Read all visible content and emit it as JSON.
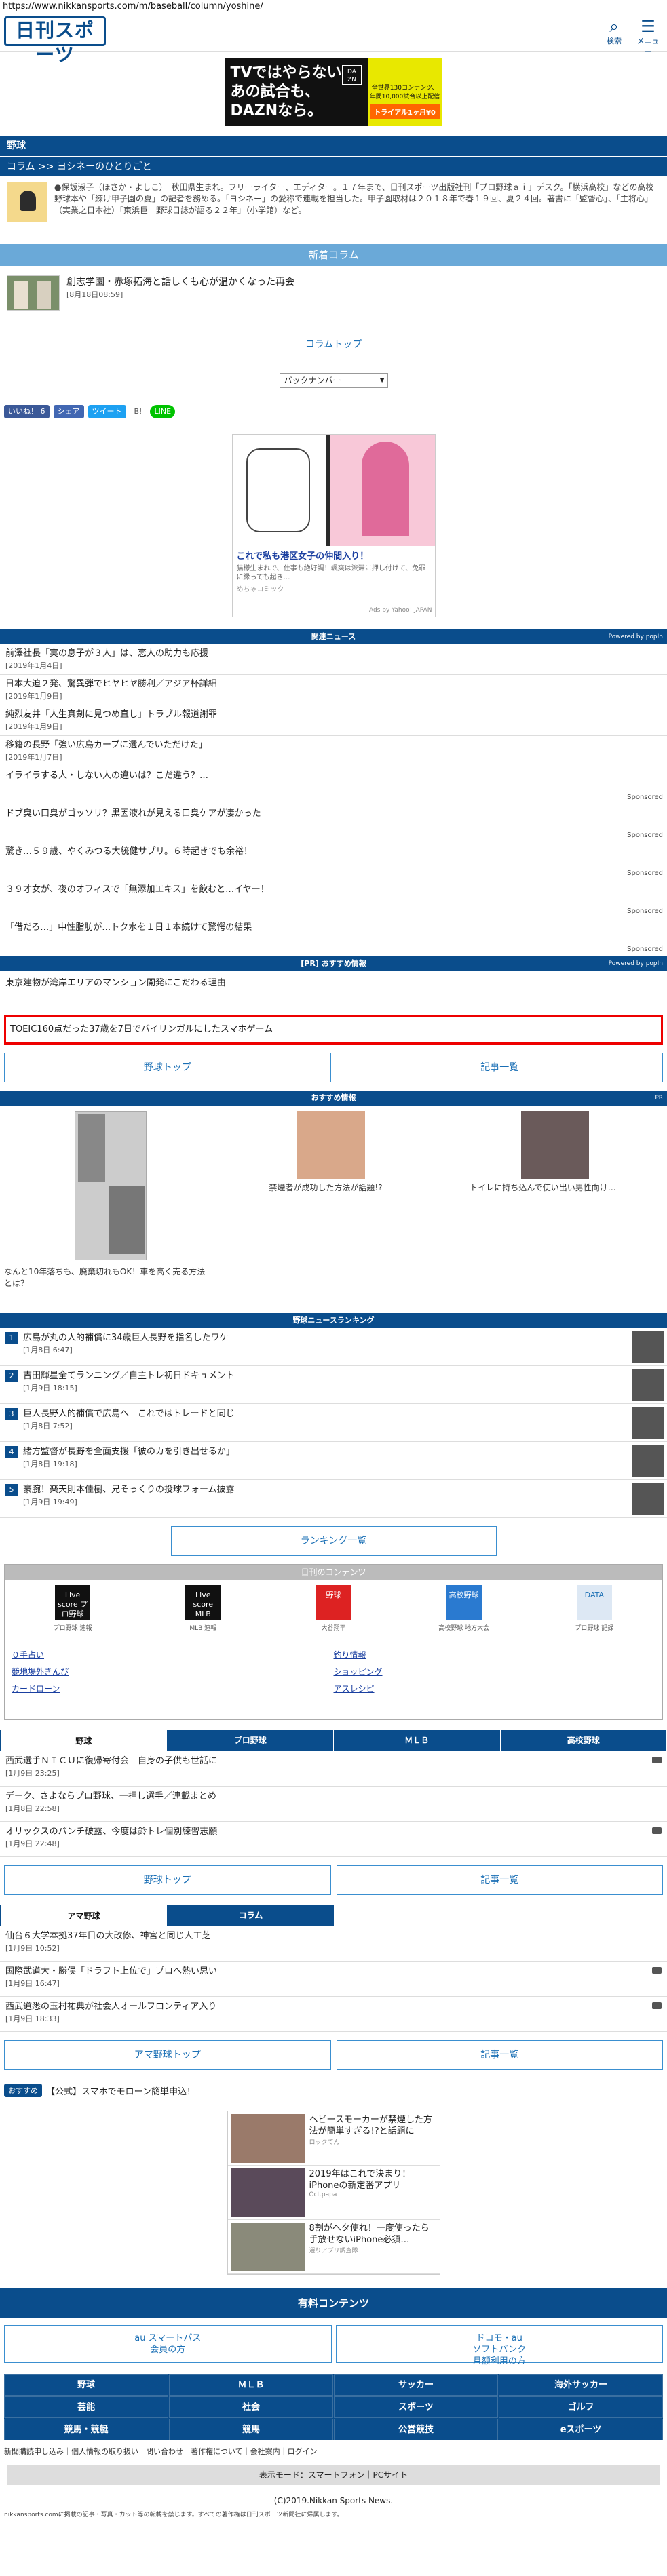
{
  "url": "https://www.nikkansports.com/m/baseball/column/yoshine/",
  "header": {
    "logo": "日刊スポーツ",
    "search_label": "検索",
    "menu_label": "メニュー"
  },
  "banner": {
    "line1": "TVではやらない",
    "line2": "あの試合も、",
    "line3": "DAZNなら。",
    "right1": "全世界130コンテンツ、",
    "right2": "年間10,000試合以上配信",
    "cta": "トライアル1ヶ月¥0"
  },
  "section": "野球",
  "column_title": "コラム >> ヨシネーのひとりごと",
  "profile": "●保坂淑子（ほさか・よしこ）　秋田県生まれ。フリーライター、エディター。１７年まで、日刊スポーツ出版社刊「プロ野球ａｉ」デスク。「横浜高校」などの高校野球本や「練け甲子園の夏」の記者を務める。「ヨシネー」の愛称で連載を担当した。甲子園取材は２０１８年で春１９回、夏２４回。著書に「監督心」、「主将心」（実業之日本社）「東浜巨　野球日誌が語る２２年」（小学館）など。",
  "new_column": {
    "head": "新着コラム",
    "title": "創志学園・赤塚拓海と話しくも心が温かくなった再会",
    "date": "[8月18日08:59]"
  },
  "column_top": "コラムトップ",
  "backnumber": "バックナンバー",
  "social": {
    "like": "いいね！ 6",
    "share": "シェア",
    "tweet": "ツイート",
    "line": "LINE"
  },
  "ad1": {
    "title": "これで私も港区女子の仲間入り！",
    "desc": "猫様生まれで、仕事も絶好調！颯爽は渋滞に押し付けて、免罪に縁っても起き…",
    "source": "めちゃコミック",
    "yahoo": "Ads by Yahoo! JAPAN"
  },
  "related": {
    "head": "関連ニュース",
    "powered": "Powered by popIn",
    "items": [
      {
        "t": "前澤社長「実の息子が３人」は、恋人の助力も応援",
        "d": "[2019年1月4日]"
      },
      {
        "t": "日本大迫２発、驚異弾でヒヤヒヤ勝利／アジア杯詳細",
        "d": "[2019年1月9日]"
      },
      {
        "t": "純烈友井「人生真剣に見つめ直し」トラブル報道謝罪",
        "d": "[2019年1月9日]"
      },
      {
        "t": "移籍の長野「強い広島カープに選んでいただけた」",
        "d": "[2019年1月7日]"
      }
    ],
    "sponsored": [
      "イライラする人・しない人の違いは？こだ違う？…",
      "ドブ臭い口臭がゴッソリ？黒因液れが見える口臭ケアが凄かった",
      "驚き…５９歳、やくみつる大統健サプリ。６時起きでも余裕！",
      "３９才女が、夜のオフィスで「無添加エキス」を飲むと…イヤー！",
      "「借だろ…」中性脂肪が…トク水を１日１本続けて驚愕の結果"
    ],
    "sponsored_label": "Sponsored"
  },
  "pr": {
    "head": "[PR] おすすめ情報",
    "powered": "Powered by popIn",
    "item": "東京建物が湾岸エリアのマンション開発にこだわる理由"
  },
  "red_item": "TOEIC160点だった37歳を7日でバイリンガルにしたスマホゲーム",
  "buttons1": {
    "left": "野球トップ",
    "right": "記事一覧"
  },
  "recommend": {
    "head": "おすすめ情報",
    "pr": "PR",
    "c1": "なんと10年落ちも、廃棄切れもOK！車を高く売る方法とは？",
    "c2": "禁煙者が成功した方法が話題!?",
    "c3": "トイレに持ち込んで使い出い男性向け…"
  },
  "ranking": {
    "head": "野球ニュースランキング",
    "items": [
      {
        "n": "1",
        "t": "広島が丸の人的補償に34歳巨人長野を指名したワケ",
        "d": "[1月8日 6:47]"
      },
      {
        "n": "2",
        "t": "吉田輝星全てランニング／自主トレ初日ドキュメント",
        "d": "[1月9日 18:15]"
      },
      {
        "n": "3",
        "t": "巨人長野人的補償で広島へ　これではトレードと同じ",
        "d": "[1月8日 7:52]"
      },
      {
        "n": "4",
        "t": "緒方監督が長野を全面支援「彼のカを引き出せるか」",
        "d": "[1月8日 19:18]"
      },
      {
        "n": "5",
        "t": "豪腕！楽天則本佳樹、兄そっくりの投球フォーム披露",
        "d": "[1月9日 19:49]"
      }
    ],
    "more": "ランキング一覧"
  },
  "paid": {
    "head": "日刊のコンテンツ",
    "apps": [
      {
        "icon": "Live score プロ野球",
        "label": "プロ野球 速報"
      },
      {
        "icon": "Live score MLB",
        "label": "MLB 速報"
      },
      {
        "icon": "野球",
        "label": "大谷翔平"
      },
      {
        "icon": "高校野球",
        "label": "高校野球 地方大会"
      },
      {
        "icon": "DATA",
        "label": "プロ野球 記録"
      }
    ],
    "links": [
      "０手占い",
      "釣り情報",
      "競地場外きんぴ",
      "ショッピング",
      "カードローン",
      "アスレシピ"
    ]
  },
  "tabs1": [
    "野球",
    "プロ野球",
    "ＭＬＢ",
    "高校野球"
  ],
  "tab_items1": [
    {
      "t": "西武選手ＮＩＣＵに復帰寄付会　自身の子供も世話に",
      "d": "[1月9日 23:25]"
    },
    {
      "t": "デーク、さよならプロ野球、一押し選手／連載まとめ",
      "d": "[1月8日 22:58]"
    },
    {
      "t": "オリックスのパンチ破露、今度は鈴トレ個別練習志願",
      "d": "[1月9日 22:48]"
    }
  ],
  "buttons2": {
    "left": "野球トップ",
    "right": "記事一覧"
  },
  "tabs2": [
    "アマ野球",
    "コラム"
  ],
  "tab_items2": [
    {
      "t": "仙台６大学本拠37年目の大改修、神宮と同じ人工芝",
      "d": "[1月9日 10:52]"
    },
    {
      "t": "国際武道大・勝俣「ドラフト上位で」プロへ熱い思い",
      "d": "[1月9日 16:47]"
    },
    {
      "t": "西武道悉の玉村祐典が社会人オールフロンティア入り",
      "d": "[1月9日 18:33]"
    }
  ],
  "buttons3": {
    "left": "アマ野球トップ",
    "right": "記事一覧"
  },
  "pickup": {
    "badge": "おすすめ",
    "text": "【公式】スマホでモローン簡単申込！"
  },
  "ad3": [
    {
      "t": "ヘビースモーカーが禁煙した方法が簡単すぎる!?と話題に",
      "s": "ロックてん"
    },
    {
      "t": "2019年はこれで決まり！iPhoneの新定番アプリ",
      "s": "Oct.papa"
    },
    {
      "t": "8割がヘタ使れ！一度使ったら手放せないiPhone必須…",
      "s": "選りアプリ調査隊"
    }
  ],
  "paid_content": "有料コンテンツ",
  "paid_buttons": {
    "left1": "au スマートパス",
    "left2": "会員の方",
    "right1": "ドコモ・au",
    "right2": "ソフトバンク",
    "right3": "月額利用の方"
  },
  "footnav": [
    "野球",
    "ＭＬＢ",
    "サッカー",
    "海外サッカー",
    "芸能",
    "社会",
    "スポーツ",
    "ゴルフ",
    "競馬・競艇",
    "競馬",
    "公営競技",
    "eスポーツ"
  ],
  "footlinks": "新聞購読申し込み｜個人情報の取り扱い｜問い合わせ｜著作権について｜会社案内｜ログイン",
  "mode": "表示モード：スマートフォン｜PCサイト",
  "copyright": "(C)2019.Nikkan Sports News.",
  "note": "nikkansports.comに掲載の記事・写真・カット等の転載を禁じます。すべての著作権は日刊スポーツ新聞社に帰属します。"
}
